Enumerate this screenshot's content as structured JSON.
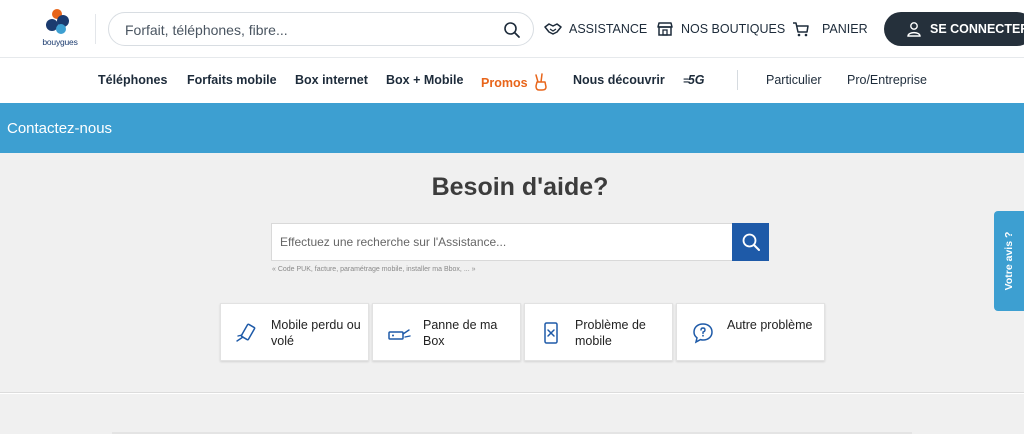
{
  "header": {
    "logo_text": "bouygues",
    "search_placeholder": "Forfait, téléphones, fibre...",
    "assistance_label": "ASSISTANCE",
    "boutiques_label": "NOS BOUTIQUES",
    "panier_label": "PANIER",
    "connect_label": "SE CONNECTER"
  },
  "nav": {
    "items": [
      {
        "label": "Téléphones"
      },
      {
        "label": "Forfaits mobile"
      },
      {
        "label": "Box internet"
      },
      {
        "label": "Box + Mobile"
      },
      {
        "label": "Promos"
      },
      {
        "label": "Nous découvrir"
      },
      {
        "label": "5G"
      },
      {
        "label": "Particulier"
      },
      {
        "label": "Pro/Entreprise"
      }
    ]
  },
  "band": {
    "title": "Contactez-nous"
  },
  "help": {
    "title": "Besoin d'aide?",
    "search_placeholder": "Effectuez une recherche sur l'Assistance...",
    "hint": "« Code PUK, facture, paramétrage mobile, installer ma Bbox, ... »",
    "cards": [
      {
        "label": "Mobile perdu ou volé",
        "icon": "lost-phone-icon"
      },
      {
        "label": "Panne de ma Box",
        "icon": "box-icon"
      },
      {
        "label": "Problème de mobile",
        "icon": "broken-phone-icon"
      },
      {
        "label": "Autre problème",
        "icon": "question-bubble-icon"
      }
    ]
  },
  "feedback": {
    "label": "Votre avis ?"
  },
  "colors": {
    "accent_blue": "#3d9fd1",
    "dark_button": "#25303b",
    "search_button": "#1e5aa8",
    "promo_orange": "#e8651a"
  }
}
